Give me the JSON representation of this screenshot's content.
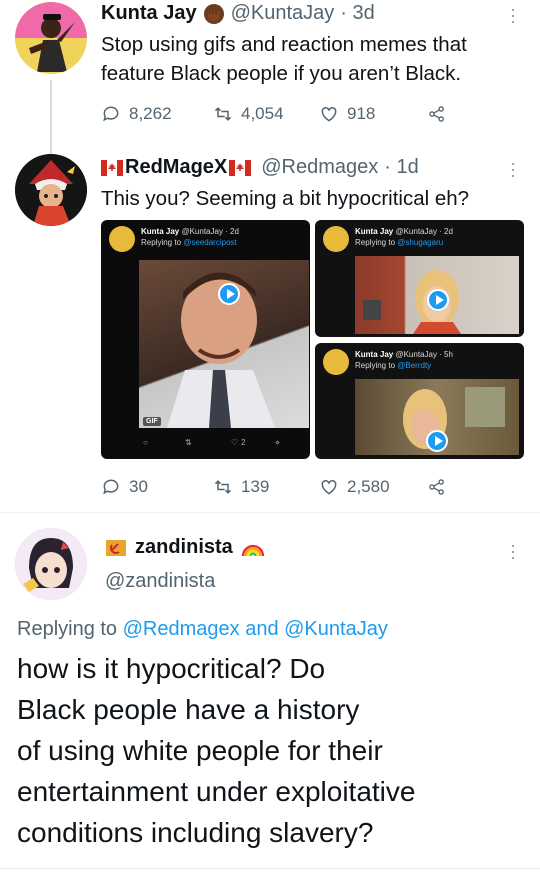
{
  "tweet1": {
    "name": "Kunta Jay",
    "handle": "@KuntaJay",
    "time": "· 3d",
    "text_line1": "Stop using gifs and reaction memes that",
    "text_line2": "feature Black people if you aren’t Black.",
    "replies": "8,262",
    "retweets": "4,054",
    "likes": "918"
  },
  "tweet2": {
    "name": "RedMageX",
    "handle": "@Redmagex",
    "time": "· 1d",
    "text": "This you?  Seeming a bit hypocritical eh?",
    "replies": "30",
    "retweets": "139",
    "likes": "2,580",
    "media": [
      {
        "name": "Kunta Jay",
        "handle": "@KuntaJay · 2d",
        "reply": "Replying to",
        "reply_to": "@seedarcipost",
        "gif": "GIF",
        "likes": "2"
      },
      {
        "name": "Kunta Jay",
        "handle": "@KuntaJay · 2d",
        "reply": "Replying to",
        "reply_to": "@shugagaru"
      },
      {
        "name": "Kunta Jay",
        "handle": "@KuntaJay · 5h",
        "reply": "Replying to",
        "reply_to": "@Berrdty"
      }
    ]
  },
  "tweet3": {
    "name": "zandinista",
    "handle": "@zandinista",
    "replying_label": "Replying to",
    "replying_users": "@Redmagex and @KuntaJay",
    "text_lines": [
      "how is it hypocritical? Do",
      "Black people have a history",
      "of using white people for their",
      "entertainment under exploitative",
      "conditions including slavery?"
    ]
  },
  "colors": {
    "accent": "#1d9bf0",
    "muted": "#536471",
    "text": "#0f1419"
  }
}
